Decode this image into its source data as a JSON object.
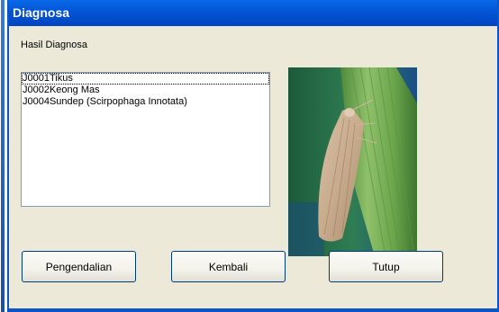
{
  "window": {
    "title": "Diagnosa"
  },
  "main": {
    "section_label": "Hasil Diagnosa",
    "list_items": [
      "J0001Tikus",
      "J0002Keong Mas",
      "J0004Sundep (Scirpophaga Innotata)"
    ]
  },
  "buttons": {
    "pengendalian": "Pengendalian",
    "kembali": "Kembali",
    "tutup": "Tutup"
  },
  "colors": {
    "titlebar": "#0356d6",
    "window_bg": "#ece9d8",
    "button_border": "#003c74"
  }
}
